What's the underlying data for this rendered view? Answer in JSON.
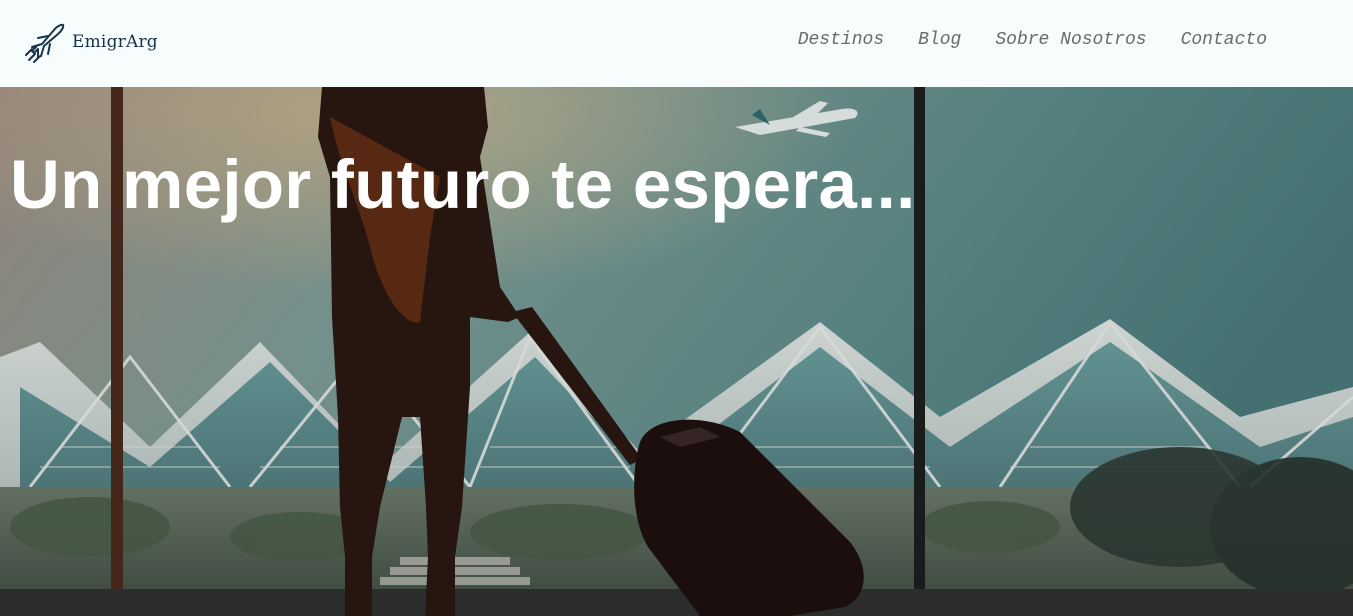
{
  "brand": {
    "name": "EmigrArg",
    "logo_icon": "airplane-icon",
    "colors": {
      "navy": "#17324a"
    }
  },
  "nav": {
    "items": [
      {
        "label": "Destinos"
      },
      {
        "label": "Blog"
      },
      {
        "label": "Sobre Nosotros"
      },
      {
        "label": "Contacto"
      }
    ]
  },
  "hero": {
    "title": "Un mejor futuro te espera...",
    "background": "woman-with-suitcase-at-airport-window-photo"
  }
}
